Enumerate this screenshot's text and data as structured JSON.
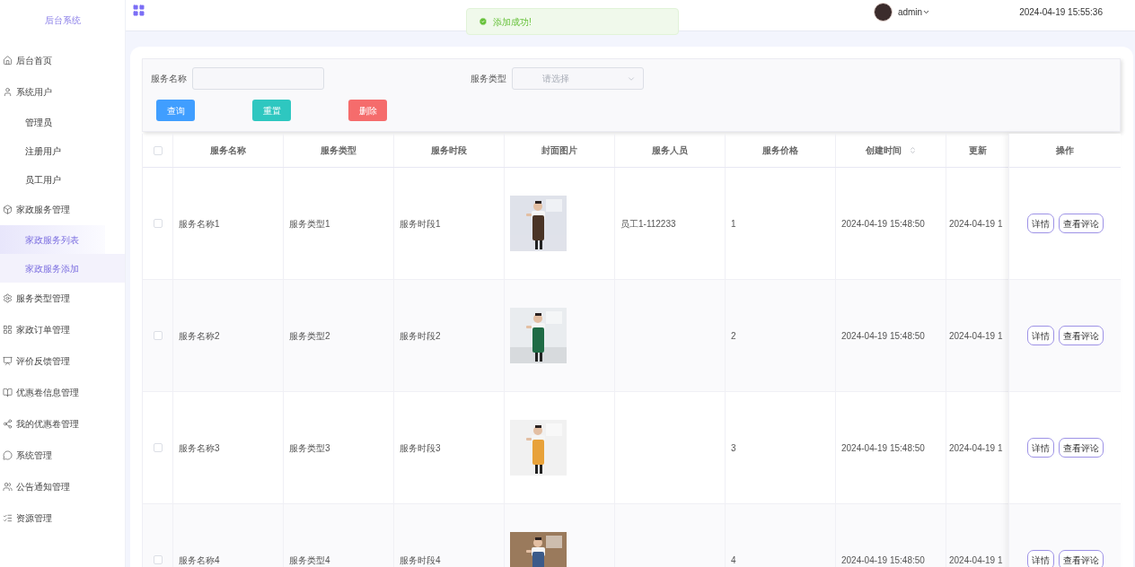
{
  "sidebar": {
    "title": "后台系统",
    "items": [
      {
        "label": "后台首页"
      },
      {
        "label": "系统用户",
        "children": [
          {
            "label": "管理员",
            "selected": false,
            "hovered": false
          },
          {
            "label": "注册用户",
            "selected": false,
            "hovered": false
          },
          {
            "label": "员工用户",
            "selected": false,
            "hovered": false
          }
        ]
      },
      {
        "label": "家政服务管理",
        "children": [
          {
            "label": "家政服务列表",
            "selected": true,
            "hovered": false
          },
          {
            "label": "家政服务添加",
            "selected": false,
            "hovered": true
          }
        ]
      },
      {
        "label": "服务类型管理"
      },
      {
        "label": "家政订单管理"
      },
      {
        "label": "评价反馈管理"
      },
      {
        "label": "优惠卷信息管理"
      },
      {
        "label": "我的优惠卷管理"
      },
      {
        "label": "系统管理"
      },
      {
        "label": "公告通知管理"
      },
      {
        "label": "资源管理"
      }
    ]
  },
  "header": {
    "user": "admin",
    "datetime": "2024-04-19 15:55:36"
  },
  "toast": {
    "message": "添加成功!"
  },
  "search": {
    "fields": [
      {
        "label": "服务名称",
        "kind": "input"
      },
      {
        "label": "服务类型",
        "kind": "select",
        "placeholder": "请选择"
      }
    ],
    "buttons": [
      {
        "label": "查询",
        "kind": "primary"
      },
      {
        "label": "重置",
        "kind": "success"
      },
      {
        "label": "删除",
        "kind": "danger"
      }
    ]
  },
  "table": {
    "header_checked": false,
    "columns": [
      {
        "label": "服务名称"
      },
      {
        "label": "服务类型"
      },
      {
        "label": "服务时段"
      },
      {
        "label": "封面图片"
      },
      {
        "label": "服务人员"
      },
      {
        "label": "服务价格"
      },
      {
        "label": "创建时间",
        "sortable": true
      },
      {
        "label": "更新"
      }
    ],
    "action_column": "操作",
    "rows": [
      {
        "checked": false,
        "cells": [
          "服务名称1",
          "服务类型1",
          "服务时段1",
          {
            "kind": "picture"
          },
          "员工1-112233",
          "1",
          "2024-04-19 15:48:50",
          "2024-04-19 1"
        ],
        "actions": [
          "详情",
          "查看评论"
        ]
      },
      {
        "checked": false,
        "cells": [
          "服务名称2",
          "服务类型2",
          "服务时段2",
          {
            "kind": "picture"
          },
          "",
          "2",
          "2024-04-19 15:48:50",
          "2024-04-19 1"
        ],
        "actions": [
          "详情",
          "查看评论"
        ]
      },
      {
        "checked": false,
        "cells": [
          "服务名称3",
          "服务类型3",
          "服务时段3",
          {
            "kind": "picture"
          },
          "",
          "3",
          "2024-04-19 15:48:50",
          "2024-04-19 1"
        ],
        "actions": [
          "详情",
          "查看评论"
        ]
      },
      {
        "checked": false,
        "cells": [
          "服务名称4",
          "服务类型4",
          "服务时段4",
          {
            "kind": "picture"
          },
          "",
          "4",
          "2024-04-19 15:48:50",
          "2024-04-19 1"
        ],
        "actions": [
          "详情",
          "查看评论"
        ]
      }
    ]
  }
}
